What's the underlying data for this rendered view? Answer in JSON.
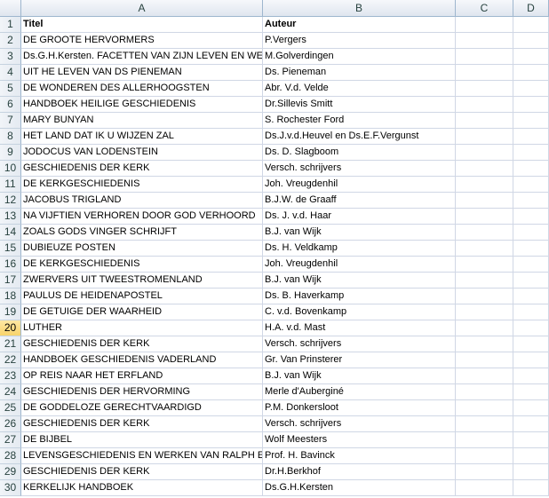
{
  "columns": [
    "A",
    "B",
    "C",
    "D"
  ],
  "selected_row": 20,
  "rows": [
    {
      "n": "1",
      "a": "Titel",
      "b": "Auteur"
    },
    {
      "n": "2",
      "a": "DE GROOTE HERVORMERS",
      "b": "P.Vergers"
    },
    {
      "n": "3",
      "a": "Ds.G.H.Kersten. FACETTEN VAN ZIJN LEVEN EN WERK",
      "b": "M.Golverdingen"
    },
    {
      "n": "4",
      "a": "UIT HE LEVEN VAN DS PIENEMAN",
      "b": "Ds. Pieneman"
    },
    {
      "n": "5",
      "a": "DE WONDEREN DES ALLERHOOGSTEN",
      "b": "Abr. V.d. Velde"
    },
    {
      "n": "6",
      "a": "HANDBOEK HEILIGE GESCHIEDENIS",
      "b": "Dr.Sillevis Smitt"
    },
    {
      "n": "7",
      "a": "MARY BUNYAN",
      "b": "S. Rochester Ford"
    },
    {
      "n": "8",
      "a": "HET LAND DAT IK U WIJZEN ZAL",
      "b": "Ds.J.v.d.Heuvel en Ds.E.F.Vergunst"
    },
    {
      "n": "9",
      "a": "JODOCUS VAN LODENSTEIN",
      "b": "Ds. D. Slagboom"
    },
    {
      "n": "10",
      "a": "GESCHIEDENIS DER KERK",
      "b": "Versch. schrijvers"
    },
    {
      "n": "11",
      "a": "DE KERKGESCHIEDENIS",
      "b": "Joh. Vreugdenhil"
    },
    {
      "n": "12",
      "a": "JACOBUS TRIGLAND",
      "b": "B.J.W. de Graaff"
    },
    {
      "n": "13",
      "a": "NA VIJFTIEN VERHOREN DOOR GOD VERHOORD",
      "b": "Ds. J. v.d. Haar"
    },
    {
      "n": "14",
      "a": "ZOALS GODS VINGER SCHRIJFT",
      "b": "B.J. van Wijk"
    },
    {
      "n": "15",
      "a": "DUBIEUZE POSTEN",
      "b": "Ds. H.  Veldkamp"
    },
    {
      "n": "16",
      "a": "DE KERKGESCHIEDENIS",
      "b": "Joh. Vreugdenhil"
    },
    {
      "n": "17",
      "a": "ZWERVERS UIT TWEESTROMENLAND",
      "b": "B.J. van Wijk"
    },
    {
      "n": "18",
      "a": "PAULUS DE HEIDENAPOSTEL",
      "b": "Ds. B. Haverkamp"
    },
    {
      "n": "19",
      "a": "DE GETUIGE DER WAARHEID",
      "b": "C. v.d. Bovenkamp"
    },
    {
      "n": "20",
      "a": "LUTHER",
      "b": "H.A. v.d. Mast"
    },
    {
      "n": "21",
      "a": "GESCHIEDENIS DER KERK",
      "b": "Versch. schrijvers"
    },
    {
      "n": "22",
      "a": "HANDBOEK GESCHIEDENIS VADERLAND",
      "b": "Gr. Van Prinsterer"
    },
    {
      "n": "23",
      "a": "OP REIS NAAR HET ERFLAND",
      "b": "B.J. van Wijk"
    },
    {
      "n": "24",
      "a": "GESCHIEDENIS DER HERVORMING",
      "b": "Merle d'Auberginé"
    },
    {
      "n": "25",
      "a": "DE GODDELOZE GERECHTVAARDIGD",
      "b": "P.M. Donkersloot"
    },
    {
      "n": "26",
      "a": "GESCHIEDENIS DER KERK",
      "b": "Versch. schrijvers"
    },
    {
      "n": "27",
      "a": "DE BIJBEL",
      "b": "Wolf Meesters"
    },
    {
      "n": "28",
      "a": "LEVENSGESCHIEDENIS EN WERKEN VAN RALPH EN EBENEZER ERSKINE",
      "b": "Prof. H. Bavinck"
    },
    {
      "n": "29",
      "a": "GESCHIEDENIS DER KERK",
      "b": "Dr.H.Berkhof"
    },
    {
      "n": "30",
      "a": "KERKELIJK HANDBOEK",
      "b": "Ds.G.H.Kersten"
    }
  ]
}
